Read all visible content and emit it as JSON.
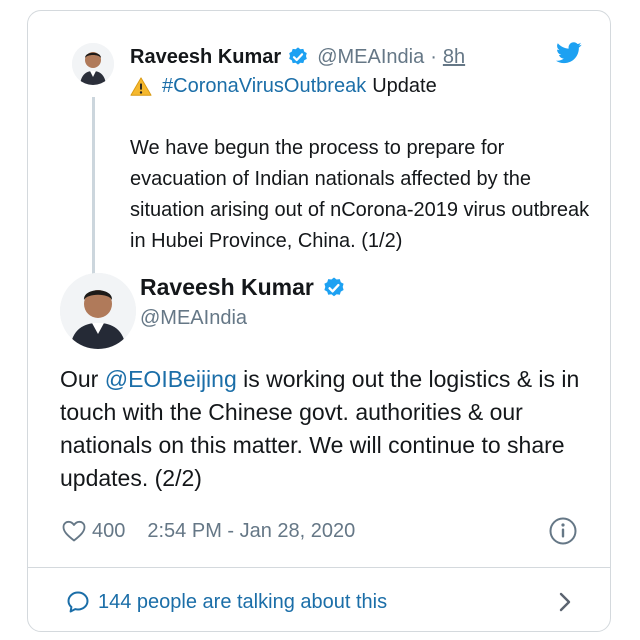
{
  "tweet1": {
    "name": "Raveesh Kumar",
    "handle": "@MEAIndia",
    "separator": "·",
    "time": "8h",
    "hashtag": "#CoronaVirusOutbreak",
    "update_label": "Update",
    "text": "We have begun the process to prepare for evacuation of Indian nationals affected by the situation arising out of nCorona-2019 virus outbreak in Hubei Province, China. (1/2)"
  },
  "tweet2": {
    "name": "Raveesh Kumar",
    "handle": "@MEAIndia",
    "text_before": "Our ",
    "mention": "@EOIBeijing",
    "text_after": " is working out the logistics & is in touch with the Chinese govt. authorities & our nationals on this matter. We will continue to share updates. (2/2)",
    "likes": "400",
    "timestamp": "2:54 PM - Jan 28, 2020"
  },
  "footer": {
    "talking": "144 people are talking about this"
  },
  "icons": {
    "verified": "verified-badge-icon",
    "bird": "twitter-bird-icon",
    "warning": "warning-icon",
    "heart": "heart-icon",
    "info": "info-icon",
    "bubble": "speech-bubble-icon",
    "chevron": "chevron-right-icon"
  },
  "colors": {
    "accent": "#1da1f2",
    "link": "#1b6ea8",
    "secondary_text": "#657786",
    "border": "#d4d9dd"
  }
}
